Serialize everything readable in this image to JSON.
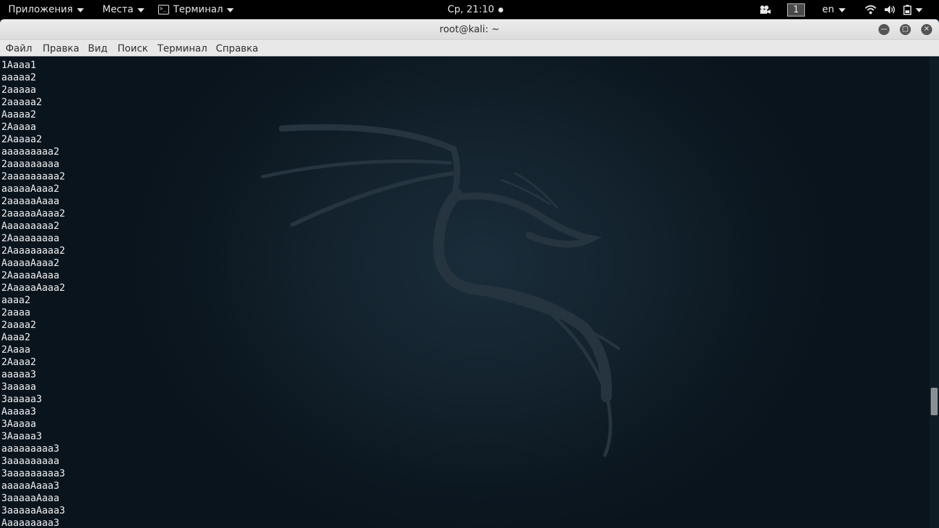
{
  "topbar": {
    "apps_label": "Приложения",
    "places_label": "Места",
    "terminal_label": "Терминал",
    "clock": "Ср, 21:10",
    "workspace": "1",
    "lang": "en"
  },
  "window": {
    "title": "root@kali: ~"
  },
  "menu": {
    "file": "Файл",
    "edit": "Правка",
    "view": "Вид",
    "search": "Поиск",
    "terminal": "Терминал",
    "help": "Справка"
  },
  "terminal": {
    "lines": [
      "1Aaaa1",
      "aaaaa2",
      "2aaaaa",
      "2aaaaa2",
      "Aaaaa2",
      "2Aaaaa",
      "2Aaaaa2",
      "aaaaaaaaa2",
      "2aaaaaaaaa",
      "2aaaaaaaaa2",
      "aaaaaAaaa2",
      "2aaaaaAaaa",
      "2aaaaaAaaa2",
      "Aaaaaaaaa2",
      "2Aaaaaaaaa",
      "2Aaaaaaaaa2",
      "AaaaaAaaa2",
      "2AaaaaAaaa",
      "2AaaaaAaaa2",
      "aaaa2",
      "2aaaa",
      "2aaaa2",
      "Aaaa2",
      "2Aaaa",
      "2Aaaa2",
      "aaaaa3",
      "3aaaaa",
      "3aaaaa3",
      "Aaaaa3",
      "3Aaaaa",
      "3Aaaaa3",
      "aaaaaaaaa3",
      "3aaaaaaaaa",
      "3aaaaaaaaa3",
      "aaaaaAaaa3",
      "3aaaaaAaaa",
      "3aaaaaAaaa3",
      "Aaaaaaaaa3"
    ]
  },
  "icons": {
    "apps_caret": "chevron-down-icon",
    "terminal_app": "terminal-icon",
    "screencast": "record-dot-icon",
    "video": "camera-icon",
    "wifi": "wifi-icon",
    "volume": "volume-icon",
    "battery": "battery-icon",
    "minimize": "minimize-icon",
    "maximize": "maximize-icon",
    "close": "close-icon",
    "wallpaper": "kali-dragon-icon"
  }
}
